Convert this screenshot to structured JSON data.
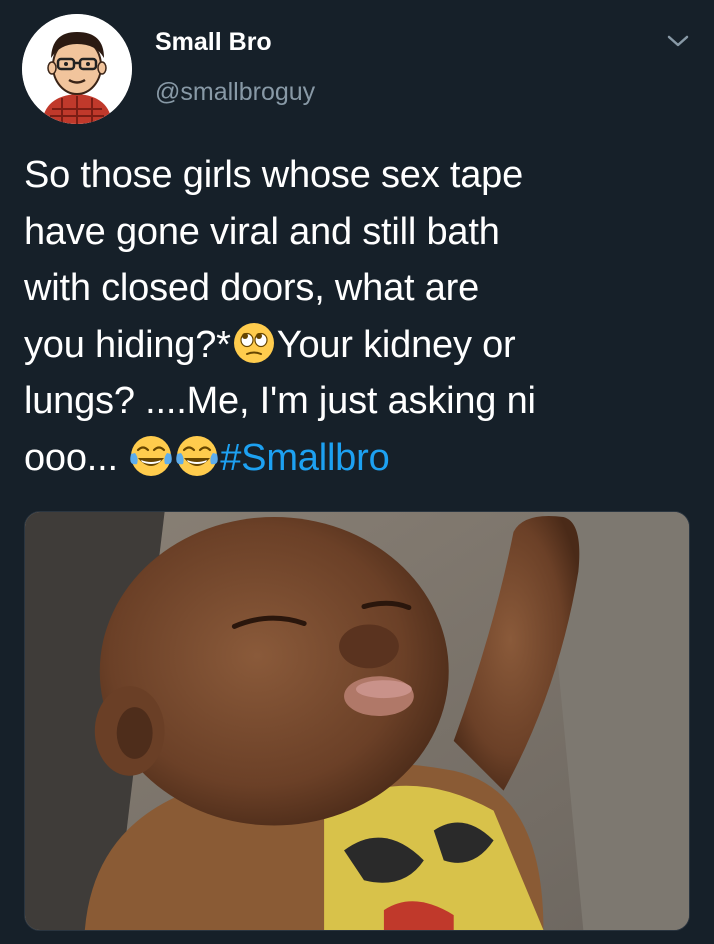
{
  "tweet": {
    "display_name": "Small Bro",
    "handle": "@smallbroguy",
    "text_lines": {
      "l1": "So those girls whose sex tape",
      "l2": "have gone viral and still bath",
      "l3": "with closed doors, what are",
      "l4a": "you hiding?*",
      "l4b": "Your kidney or",
      "l5": "lungs? ....Me, I'm just asking ni",
      "l6": "ooo... "
    },
    "hashtag": "#Smallbro",
    "emoji_names": [
      "face-with-rolling-eyes",
      "face-with-tears-of-joy",
      "face-with-tears-of-joy"
    ],
    "link_color": "#1da1f2"
  },
  "media": {
    "icon": "photo-baby-sleeping"
  },
  "colors": {
    "background": "#162029",
    "handle": "#8899a6",
    "text": "#ffffff"
  }
}
